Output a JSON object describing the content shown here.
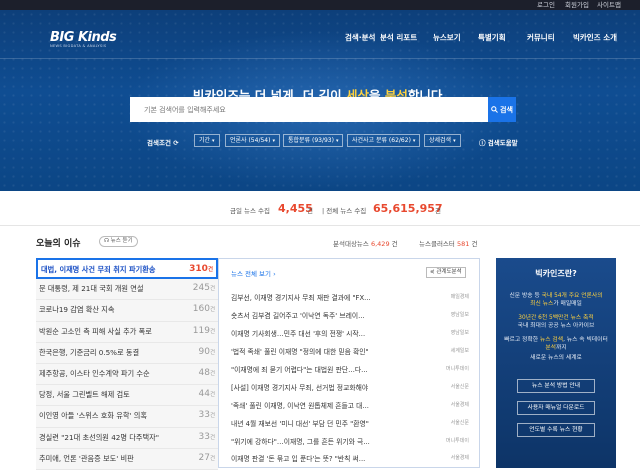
{
  "top_links": [
    "로그인",
    "회원가입",
    "사이트맵"
  ],
  "logo": {
    "word": "BIG Kinds",
    "tagline": "NEWS BIGDATA & ANALYSIS"
  },
  "nav": [
    "검색·분석",
    "분석 리포트",
    "뉴스보기",
    "특별기획",
    "커뮤니티",
    "빅카인즈 소개"
  ],
  "headline": {
    "p1": "빅카인즈",
    "p2": "는 더 넓게, 더 깊이 ",
    "p3": "세상",
    "p4": "을 ",
    "p5": "분석",
    "p6": "합니다."
  },
  "search": {
    "placeholder": "기본 검색어를 입력해주세요",
    "button": "검색"
  },
  "filters": {
    "label": "검색조건",
    "items": [
      "기간",
      "언론사 (54/54)",
      "통합분류 (93/93)",
      "사건사고 분류 (62/62)",
      "상세검색"
    ],
    "help": "검색도움말"
  },
  "stats": {
    "today_label": "금일 뉴스 수집",
    "today_value": "4,455",
    "total_label": "| 전체 뉴스 수집",
    "total_value": "65,615,957",
    "unit": "건"
  },
  "issues": {
    "title": "오늘의 이슈",
    "listen": "뉴스 듣기",
    "analysis_label": "분석대상뉴스",
    "analysis_value": "6,429",
    "cluster_label": "뉴스클러스터",
    "cluster_value": "581",
    "unit": "건",
    "items": [
      {
        "title": "대법, 이재명 사건 무죄 취지 파기환송",
        "count": "310"
      },
      {
        "title": "문 대통령, 제 21대 국회 개원 연설",
        "count": "245"
      },
      {
        "title": "코로나19 감염 확산 지속",
        "count": "160"
      },
      {
        "title": "박원순 고소인 측 피해 사실 추가 폭로",
        "count": "119"
      },
      {
        "title": "한국은행, 기준금리 0.5%로 동결",
        "count": "90"
      },
      {
        "title": "제주항공, 이스타 인수계약 파기 수순",
        "count": "48"
      },
      {
        "title": "당정, 서울 그린벨트 해제 검토",
        "count": "44"
      },
      {
        "title": "이인영 아들 '스위스 호화 유학' 의혹",
        "count": "33"
      },
      {
        "title": "경실련 \"21대 초선의원 42명 다주택자\"",
        "count": "33"
      },
      {
        "title": "추미애, 언론 '관음증 보도' 비판",
        "count": "27"
      }
    ]
  },
  "news": {
    "heading": "뉴스 전체 보기",
    "button": "관계도분석",
    "rows": [
      {
        "title": "김부선, 이재명 경기지사 무죄 재판 결과에 \"FX...",
        "press": "매일경제"
      },
      {
        "title": "숏츠서 김부겸 길어주고 '이낙연 독주' 브레이...",
        "press": "영남일보"
      },
      {
        "title": "이재명 기사회생…민주 대선 '후의 전쟁' 시작...",
        "press": "영남일보"
      },
      {
        "title": "'법적 족쇄' 풀린 이재명 \"정의에 대한 믿음 확인\"",
        "press": "세계일보"
      },
      {
        "title": "\"이재명에 죄 묻기 어렵다\"는 대법원 판단…다...",
        "press": "머니투데이"
      },
      {
        "title": "[사설] 이재명 경기지사 무죄, 선거법 정교화해야",
        "press": "서울신문"
      },
      {
        "title": "'족쇄' 풀린 이재명, 이낙연 원톱체제 흔들고 대...",
        "press": "서울경제"
      },
      {
        "title": "내년 4월 재보선 '미니 대선' 부담 던 민주 \"환영\"",
        "press": "서울신문"
      },
      {
        "title": "\"위기에 강하다\"…이재명, 그를 흔든 위기와 극...",
        "press": "머니투데이"
      },
      {
        "title": "이재명 판결 '돈 묶고 입 푼다'는 뜻? \"반칙 써...",
        "press": "서울경제"
      }
    ]
  },
  "side": {
    "title": "빅카인즈란?",
    "desc1a": "신문 방송 등 ",
    "desc1b": "국내 54개 주요 언론사의",
    "desc1c": "최신 뉴스",
    "desc1d": "가 매일매일",
    "desc2a": "30년간 6천 5백만건 뉴스 축적",
    "desc2b": "국내 최대의 공공 뉴스 아카이브",
    "desc3a": "빠르고 정확한 ",
    "desc3b": "뉴스 검색",
    "desc3c": ", 뉴스 속 빅데이터 ",
    "desc3d": "분석",
    "desc3e": "까지",
    "desc4": "새로운 뉴스의 세계로",
    "buttons": [
      "뉴스 분석 방법 안내",
      "사용자 매뉴얼 다운로드",
      "언도별 수록 뉴스 현황"
    ]
  }
}
